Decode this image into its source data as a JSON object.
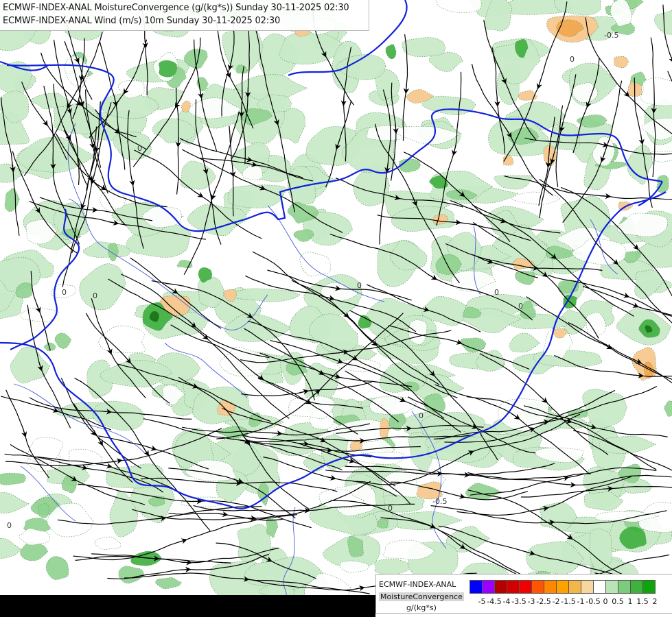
{
  "title": {
    "line1": "ECMWF-INDEX-ANAL MoistureConvergence (g/(kg*s)) Sunday 30-11-2025 02:30",
    "line2": "ECMWF-INDEX-ANAL Wind (m/s) 10m Sunday 30-11-2025 02:30"
  },
  "map": {
    "contour_labels": [
      "0",
      "0",
      "0",
      "0",
      "0",
      "0",
      "0",
      "0",
      "0",
      "0",
      "0",
      "-0.5",
      "-0.5"
    ],
    "colors": {
      "converge_light": "#c8eac7",
      "converge_mid": "#8fd18e",
      "converge_dark": "#3dae3d",
      "converge_max": "#1a7a1a",
      "diverge_light": "#fde0ad",
      "diverge_mid": "#f8c88e",
      "diverge_dark": "#f1a64c",
      "border": "#1122dd",
      "river": "#4b5cd6",
      "streamline": "#000000"
    }
  },
  "legend": {
    "model": "ECMWF-INDEX-ANAL",
    "parameter": "MoistureConvergence",
    "unit": "g/(kg*s)",
    "ticks": [
      "-5",
      "-4.5",
      "-4",
      "-3.5",
      "-3",
      "-2.5",
      "-2",
      "-1.5",
      "-1",
      "-0.5",
      "0",
      "0.5",
      "1",
      "1.5",
      "2"
    ],
    "colors": [
      "#0000ff",
      "#9900ff",
      "#b40000",
      "#d40000",
      "#f00000",
      "#ff5500",
      "#ff8800",
      "#ffa200",
      "#f4b54a",
      "#f7d79e",
      "#ffffff",
      "#b8e4b6",
      "#7dcb7c",
      "#3db23d",
      "#0da40d"
    ]
  }
}
